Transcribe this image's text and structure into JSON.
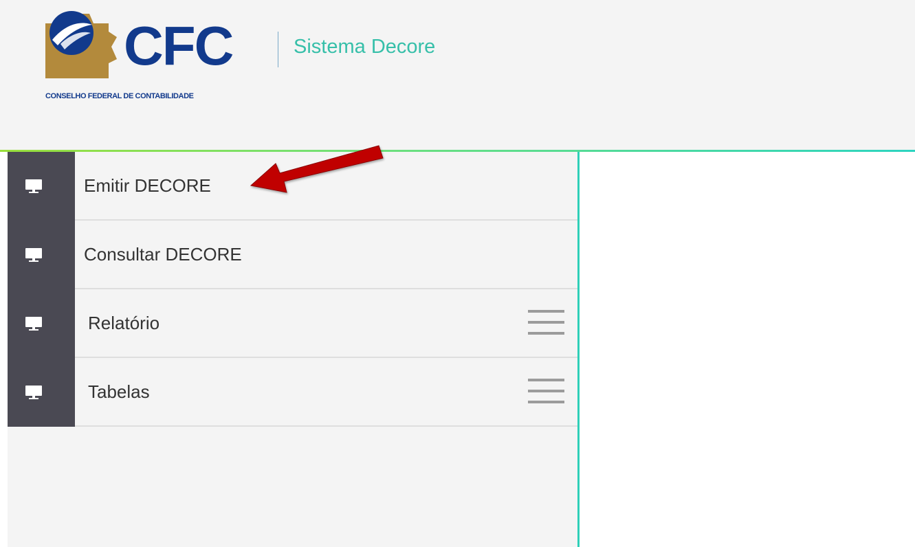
{
  "header": {
    "logo": {
      "text": "CFC",
      "caption": "CONSELHO FEDERAL DE CONTABILIDADE"
    },
    "system_title": "Sistema Decore"
  },
  "colors": {
    "brand_blue": "#123a8c",
    "brand_gold": "#b38a3c",
    "accent_teal": "#2fcfb8",
    "title_teal": "#36bfa9",
    "accent_green": "#9adf3c",
    "icon_cell": "#4a4953",
    "arrow_red": "#c00000"
  },
  "sidebar": {
    "items": [
      {
        "label": "Emitir DECORE",
        "icon": "monitor-icon",
        "has_submenu": false
      },
      {
        "label": "Consultar DECORE",
        "icon": "monitor-icon",
        "has_submenu": false
      },
      {
        "label": "Relatório",
        "icon": "monitor-icon",
        "has_submenu": true
      },
      {
        "label": "Tabelas",
        "icon": "monitor-icon",
        "has_submenu": true
      }
    ]
  },
  "annotation": {
    "type": "arrow",
    "points_to": "Emitir DECORE"
  }
}
